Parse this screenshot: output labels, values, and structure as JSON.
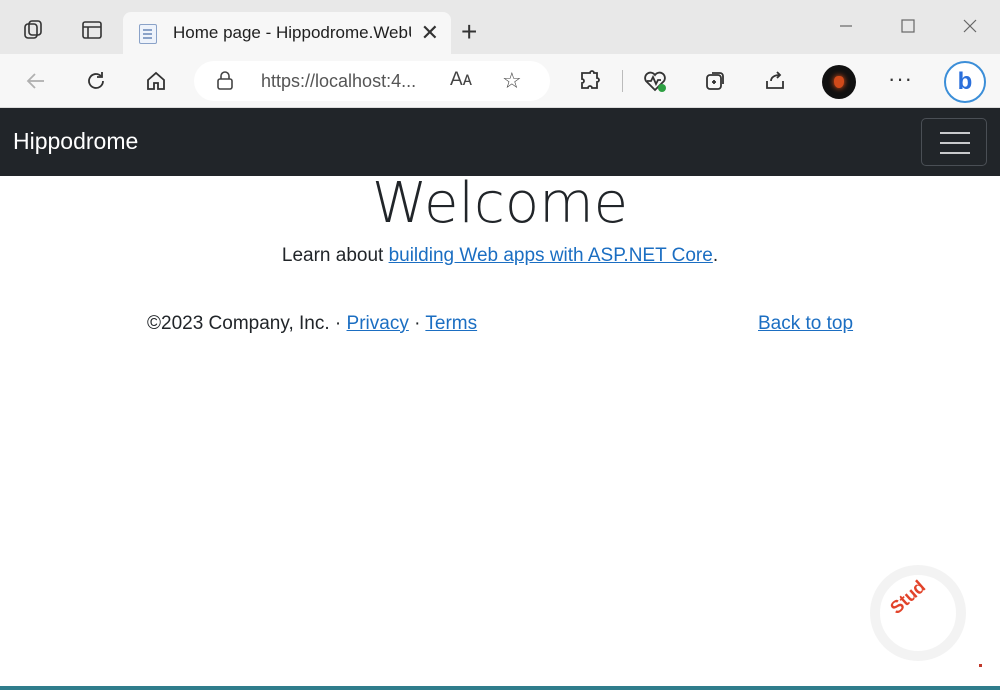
{
  "browser": {
    "tab_title": "Home page - Hippodrome.WebU",
    "url": "https://localhost:4...",
    "read_aloud": "Aᴀ"
  },
  "site": {
    "brand": "Hippodrome",
    "heading": "Welcome",
    "learn_prefix": "Learn about ",
    "learn_link": "building Web apps with ASP.NET Core",
    "learn_suffix": "."
  },
  "footer": {
    "copyright": "©2023 Company, Inc. · ",
    "privacy": "Privacy",
    "separator": " · ",
    "terms": "Terms",
    "back_to_top": "Back to top"
  },
  "watermark": {
    "text": "Stud"
  },
  "colors": {
    "navbar": "#212529",
    "link": "#1b6ec2",
    "accent_line": "#2f7d8c"
  }
}
